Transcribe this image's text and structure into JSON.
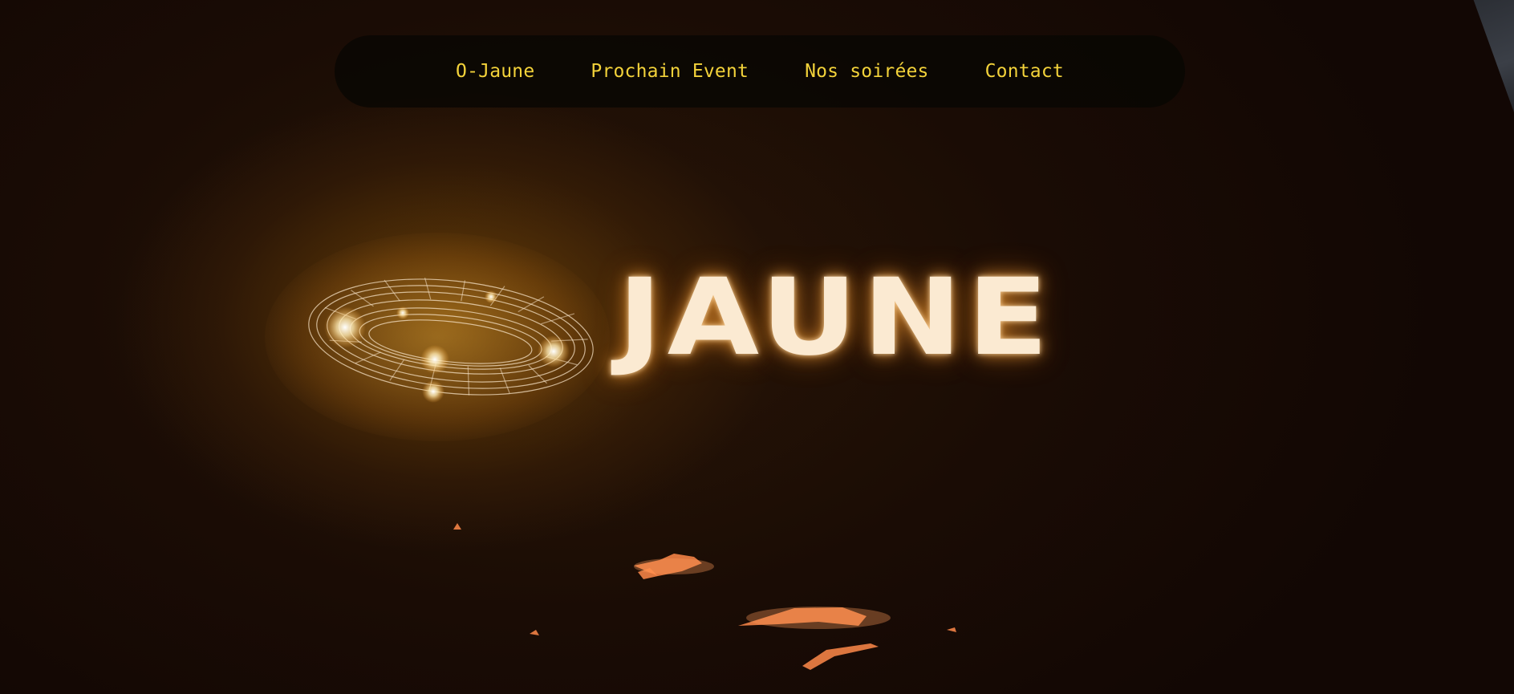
{
  "nav": {
    "items": [
      {
        "label": "O-Jaune"
      },
      {
        "label": "Prochain Event"
      },
      {
        "label": "Nos soirées"
      },
      {
        "label": "Contact"
      }
    ]
  },
  "hero": {
    "logo_text": "JAUNE"
  },
  "colors": {
    "nav_text": "#f3d23a",
    "background": "#120804",
    "glow": "#ffb040"
  }
}
